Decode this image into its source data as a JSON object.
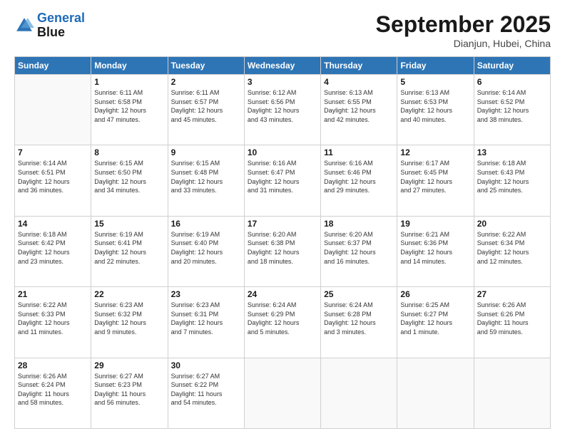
{
  "header": {
    "logo_line1": "General",
    "logo_line2": "Blue",
    "month": "September 2025",
    "location": "Dianjun, Hubei, China"
  },
  "weekdays": [
    "Sunday",
    "Monday",
    "Tuesday",
    "Wednesday",
    "Thursday",
    "Friday",
    "Saturday"
  ],
  "weeks": [
    [
      {
        "day": "",
        "info": ""
      },
      {
        "day": "1",
        "info": "Sunrise: 6:11 AM\nSunset: 6:58 PM\nDaylight: 12 hours\nand 47 minutes."
      },
      {
        "day": "2",
        "info": "Sunrise: 6:11 AM\nSunset: 6:57 PM\nDaylight: 12 hours\nand 45 minutes."
      },
      {
        "day": "3",
        "info": "Sunrise: 6:12 AM\nSunset: 6:56 PM\nDaylight: 12 hours\nand 43 minutes."
      },
      {
        "day": "4",
        "info": "Sunrise: 6:13 AM\nSunset: 6:55 PM\nDaylight: 12 hours\nand 42 minutes."
      },
      {
        "day": "5",
        "info": "Sunrise: 6:13 AM\nSunset: 6:53 PM\nDaylight: 12 hours\nand 40 minutes."
      },
      {
        "day": "6",
        "info": "Sunrise: 6:14 AM\nSunset: 6:52 PM\nDaylight: 12 hours\nand 38 minutes."
      }
    ],
    [
      {
        "day": "7",
        "info": "Sunrise: 6:14 AM\nSunset: 6:51 PM\nDaylight: 12 hours\nand 36 minutes."
      },
      {
        "day": "8",
        "info": "Sunrise: 6:15 AM\nSunset: 6:50 PM\nDaylight: 12 hours\nand 34 minutes."
      },
      {
        "day": "9",
        "info": "Sunrise: 6:15 AM\nSunset: 6:48 PM\nDaylight: 12 hours\nand 33 minutes."
      },
      {
        "day": "10",
        "info": "Sunrise: 6:16 AM\nSunset: 6:47 PM\nDaylight: 12 hours\nand 31 minutes."
      },
      {
        "day": "11",
        "info": "Sunrise: 6:16 AM\nSunset: 6:46 PM\nDaylight: 12 hours\nand 29 minutes."
      },
      {
        "day": "12",
        "info": "Sunrise: 6:17 AM\nSunset: 6:45 PM\nDaylight: 12 hours\nand 27 minutes."
      },
      {
        "day": "13",
        "info": "Sunrise: 6:18 AM\nSunset: 6:43 PM\nDaylight: 12 hours\nand 25 minutes."
      }
    ],
    [
      {
        "day": "14",
        "info": "Sunrise: 6:18 AM\nSunset: 6:42 PM\nDaylight: 12 hours\nand 23 minutes."
      },
      {
        "day": "15",
        "info": "Sunrise: 6:19 AM\nSunset: 6:41 PM\nDaylight: 12 hours\nand 22 minutes."
      },
      {
        "day": "16",
        "info": "Sunrise: 6:19 AM\nSunset: 6:40 PM\nDaylight: 12 hours\nand 20 minutes."
      },
      {
        "day": "17",
        "info": "Sunrise: 6:20 AM\nSunset: 6:38 PM\nDaylight: 12 hours\nand 18 minutes."
      },
      {
        "day": "18",
        "info": "Sunrise: 6:20 AM\nSunset: 6:37 PM\nDaylight: 12 hours\nand 16 minutes."
      },
      {
        "day": "19",
        "info": "Sunrise: 6:21 AM\nSunset: 6:36 PM\nDaylight: 12 hours\nand 14 minutes."
      },
      {
        "day": "20",
        "info": "Sunrise: 6:22 AM\nSunset: 6:34 PM\nDaylight: 12 hours\nand 12 minutes."
      }
    ],
    [
      {
        "day": "21",
        "info": "Sunrise: 6:22 AM\nSunset: 6:33 PM\nDaylight: 12 hours\nand 11 minutes."
      },
      {
        "day": "22",
        "info": "Sunrise: 6:23 AM\nSunset: 6:32 PM\nDaylight: 12 hours\nand 9 minutes."
      },
      {
        "day": "23",
        "info": "Sunrise: 6:23 AM\nSunset: 6:31 PM\nDaylight: 12 hours\nand 7 minutes."
      },
      {
        "day": "24",
        "info": "Sunrise: 6:24 AM\nSunset: 6:29 PM\nDaylight: 12 hours\nand 5 minutes."
      },
      {
        "day": "25",
        "info": "Sunrise: 6:24 AM\nSunset: 6:28 PM\nDaylight: 12 hours\nand 3 minutes."
      },
      {
        "day": "26",
        "info": "Sunrise: 6:25 AM\nSunset: 6:27 PM\nDaylight: 12 hours\nand 1 minute."
      },
      {
        "day": "27",
        "info": "Sunrise: 6:26 AM\nSunset: 6:26 PM\nDaylight: 11 hours\nand 59 minutes."
      }
    ],
    [
      {
        "day": "28",
        "info": "Sunrise: 6:26 AM\nSunset: 6:24 PM\nDaylight: 11 hours\nand 58 minutes."
      },
      {
        "day": "29",
        "info": "Sunrise: 6:27 AM\nSunset: 6:23 PM\nDaylight: 11 hours\nand 56 minutes."
      },
      {
        "day": "30",
        "info": "Sunrise: 6:27 AM\nSunset: 6:22 PM\nDaylight: 11 hours\nand 54 minutes."
      },
      {
        "day": "",
        "info": ""
      },
      {
        "day": "",
        "info": ""
      },
      {
        "day": "",
        "info": ""
      },
      {
        "day": "",
        "info": ""
      }
    ]
  ]
}
